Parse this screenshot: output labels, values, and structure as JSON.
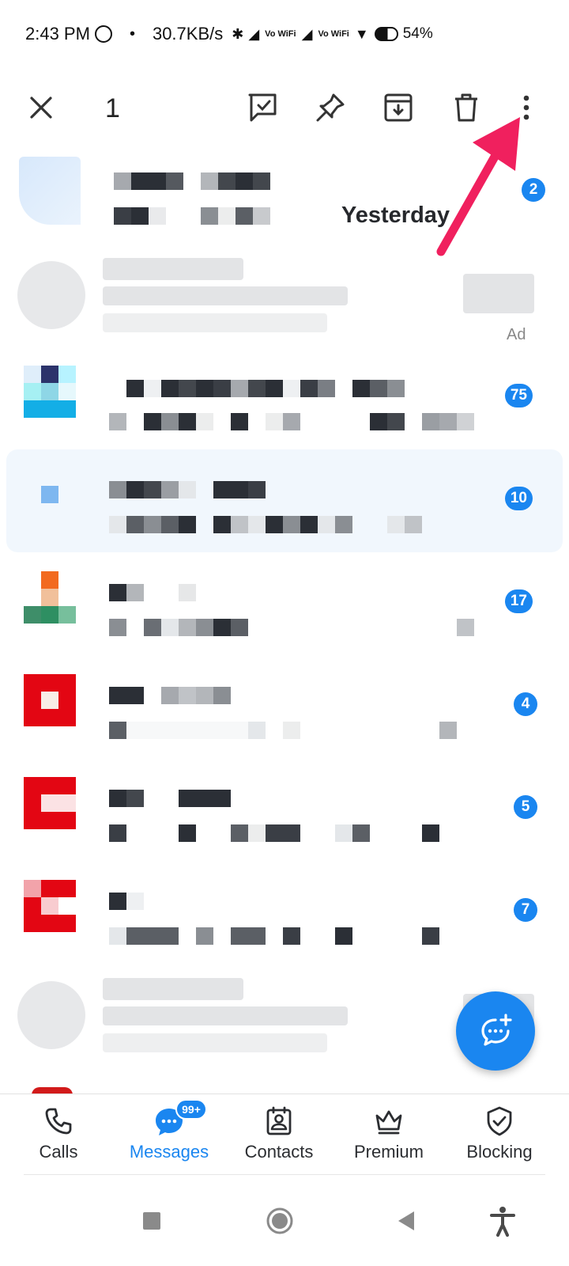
{
  "status_bar": {
    "time": "2:43 PM",
    "separator": "•",
    "speed": "30.7KB/s",
    "vowifi_1": "Vo WiFi",
    "vowifi_2": "Vo WiFi",
    "battery": "54%"
  },
  "toolbar": {
    "selected_count": "1",
    "icons": [
      "close-icon",
      "mark-read-icon",
      "pin-icon",
      "archive-icon",
      "delete-icon",
      "more-options-icon"
    ]
  },
  "conversations": [
    {
      "badge": "2",
      "time": "Yesterday"
    },
    {
      "ad_label": "Ad"
    },
    {
      "badge": "75"
    },
    {
      "badge": "10",
      "selected": true
    },
    {
      "badge": "17"
    },
    {
      "badge": "4"
    },
    {
      "badge": "5"
    },
    {
      "badge": "7"
    }
  ],
  "fab": {
    "icon": "new-message-icon"
  },
  "bottom_nav": {
    "items": [
      {
        "label": "Calls",
        "icon": "phone-icon"
      },
      {
        "label": "Messages",
        "icon": "chat-icon",
        "badge": "99+",
        "active": true
      },
      {
        "label": "Contacts",
        "icon": "contacts-icon"
      },
      {
        "label": "Premium",
        "icon": "crown-icon"
      },
      {
        "label": "Blocking",
        "icon": "shield-check-icon"
      }
    ]
  },
  "colors": {
    "accent": "#1a86f0",
    "arrow": "#f0205e",
    "selected_row": "#f1f7fd"
  }
}
